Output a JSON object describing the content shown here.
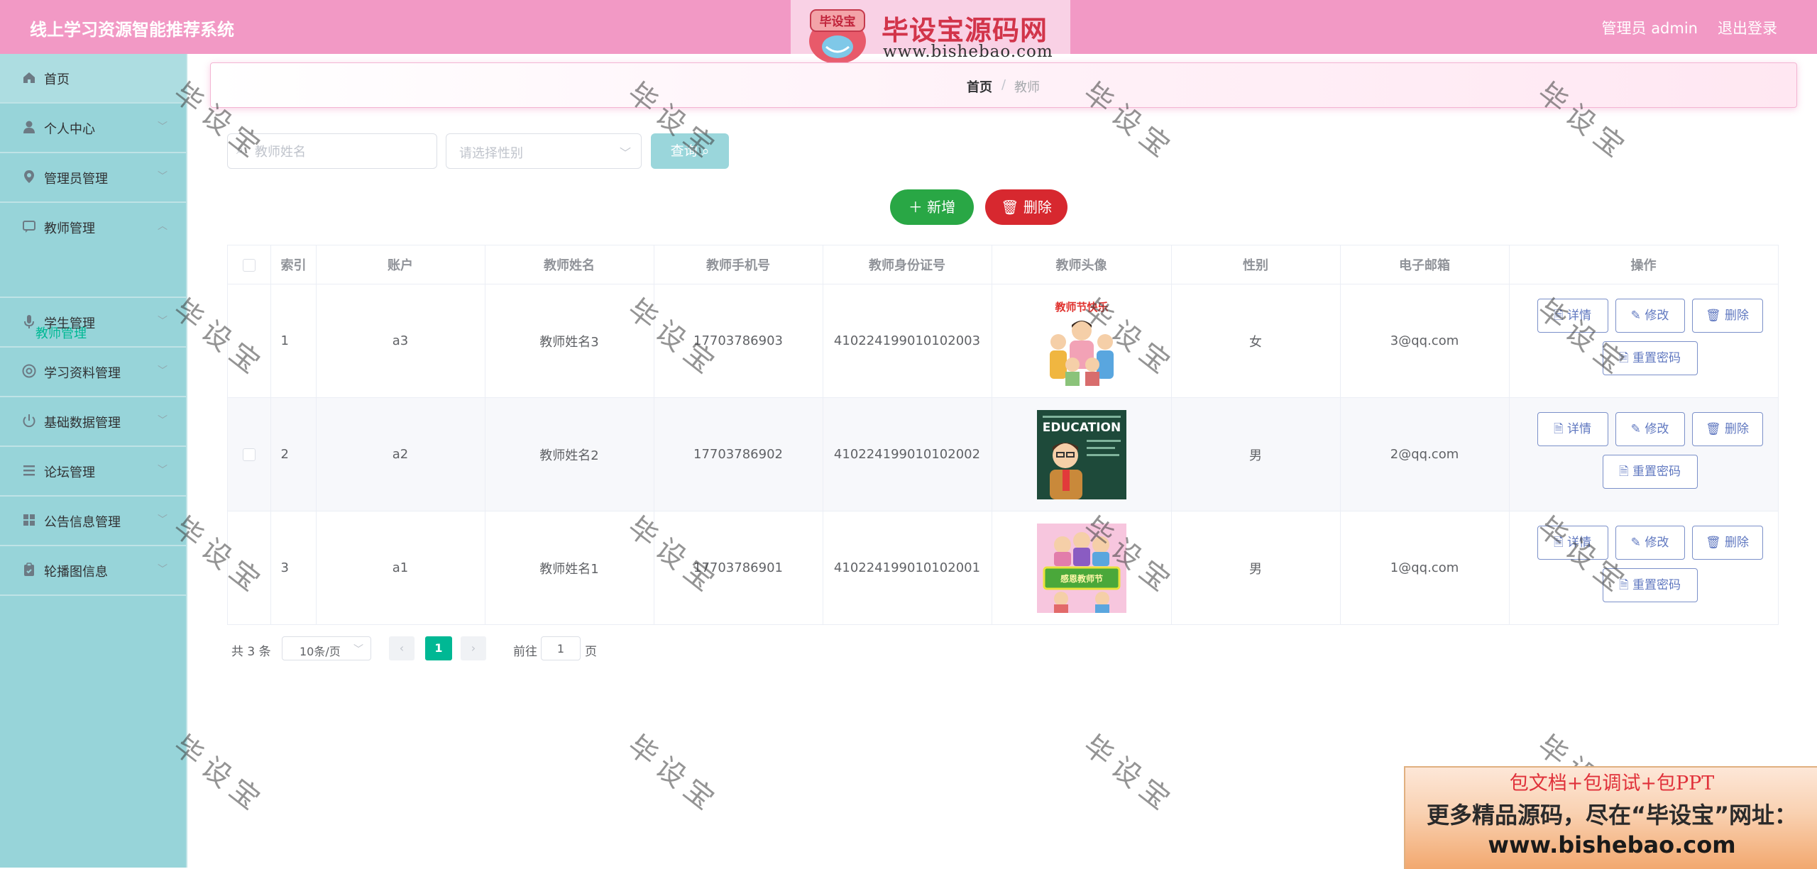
{
  "header": {
    "title": "线上学习资源智能推荐系统",
    "admin_label": "管理员 admin",
    "logout": "退出登录",
    "logo_badge": "毕设宝",
    "logo_name": "毕设宝源码网",
    "logo_url": "www.bishebao.com"
  },
  "sidebar": {
    "items": [
      {
        "label": "首页",
        "icon": "home-icon"
      },
      {
        "label": "个人中心",
        "icon": "user-icon"
      },
      {
        "label": "管理员管理",
        "icon": "location-icon"
      },
      {
        "label": "教师管理",
        "icon": "chat-icon"
      },
      {
        "label": "学生管理",
        "icon": "mic-icon"
      },
      {
        "label": "学习资料管理",
        "icon": "globe-icon"
      },
      {
        "label": "基础数据管理",
        "icon": "power-icon"
      },
      {
        "label": "论坛管理",
        "icon": "menu-icon"
      },
      {
        "label": "公告信息管理",
        "icon": "grid-icon"
      },
      {
        "label": "轮播图信息",
        "icon": "clipboard-icon"
      }
    ],
    "active_sub": "教师管理"
  },
  "breadcrumb": {
    "home": "首页",
    "separator": "/",
    "current": "教师"
  },
  "search": {
    "name_placeholder": "教师姓名",
    "gender_placeholder": "请选择性别",
    "query_label": "查询"
  },
  "actions": {
    "add_label": "新增",
    "delete_label": "删除"
  },
  "table": {
    "headers": [
      "索引",
      "账户",
      "教师姓名",
      "教师手机号",
      "教师身份证号",
      "教师头像",
      "性别",
      "电子邮箱",
      "操作"
    ],
    "rows": [
      {
        "index": "1",
        "account": "a3",
        "name": "教师姓名3",
        "phone": "17703786903",
        "id_card": "410224199010102003",
        "gender": "女",
        "email": "3@qq.com",
        "avatar_text": "教师节快乐"
      },
      {
        "index": "2",
        "account": "a2",
        "name": "教师姓名2",
        "phone": "17703786902",
        "id_card": "410224199010102002",
        "gender": "男",
        "email": "2@qq.com",
        "avatar_text": "EDUCATION"
      },
      {
        "index": "3",
        "account": "a1",
        "name": "教师姓名1",
        "phone": "17703786901",
        "id_card": "410224199010102001",
        "gender": "男",
        "email": "1@qq.com",
        "avatar_text": "感恩教师节"
      }
    ],
    "op_labels": {
      "detail": "详情",
      "edit": "修改",
      "remove": "删除",
      "reset": "重置密码"
    }
  },
  "pagination": {
    "total": "共 3 条",
    "page_size": "10条/页",
    "current_page": "1",
    "goto_label": "前往",
    "goto_value": "1",
    "goto_suffix": "页"
  },
  "watermark": "毕设宝",
  "promo": {
    "line1": "包文档+包调试+包PPT",
    "line2": "更多精品源码，尽在“毕设宝”网址：",
    "line3": "www.bishebao.com"
  },
  "colors": {
    "header_bg": "#f299c5",
    "sidebar_bg": "#97d4d9",
    "accent": "#00b894",
    "add_button": "#29a745",
    "delete_button": "#d7282f",
    "query_button": "#9ad6db"
  }
}
